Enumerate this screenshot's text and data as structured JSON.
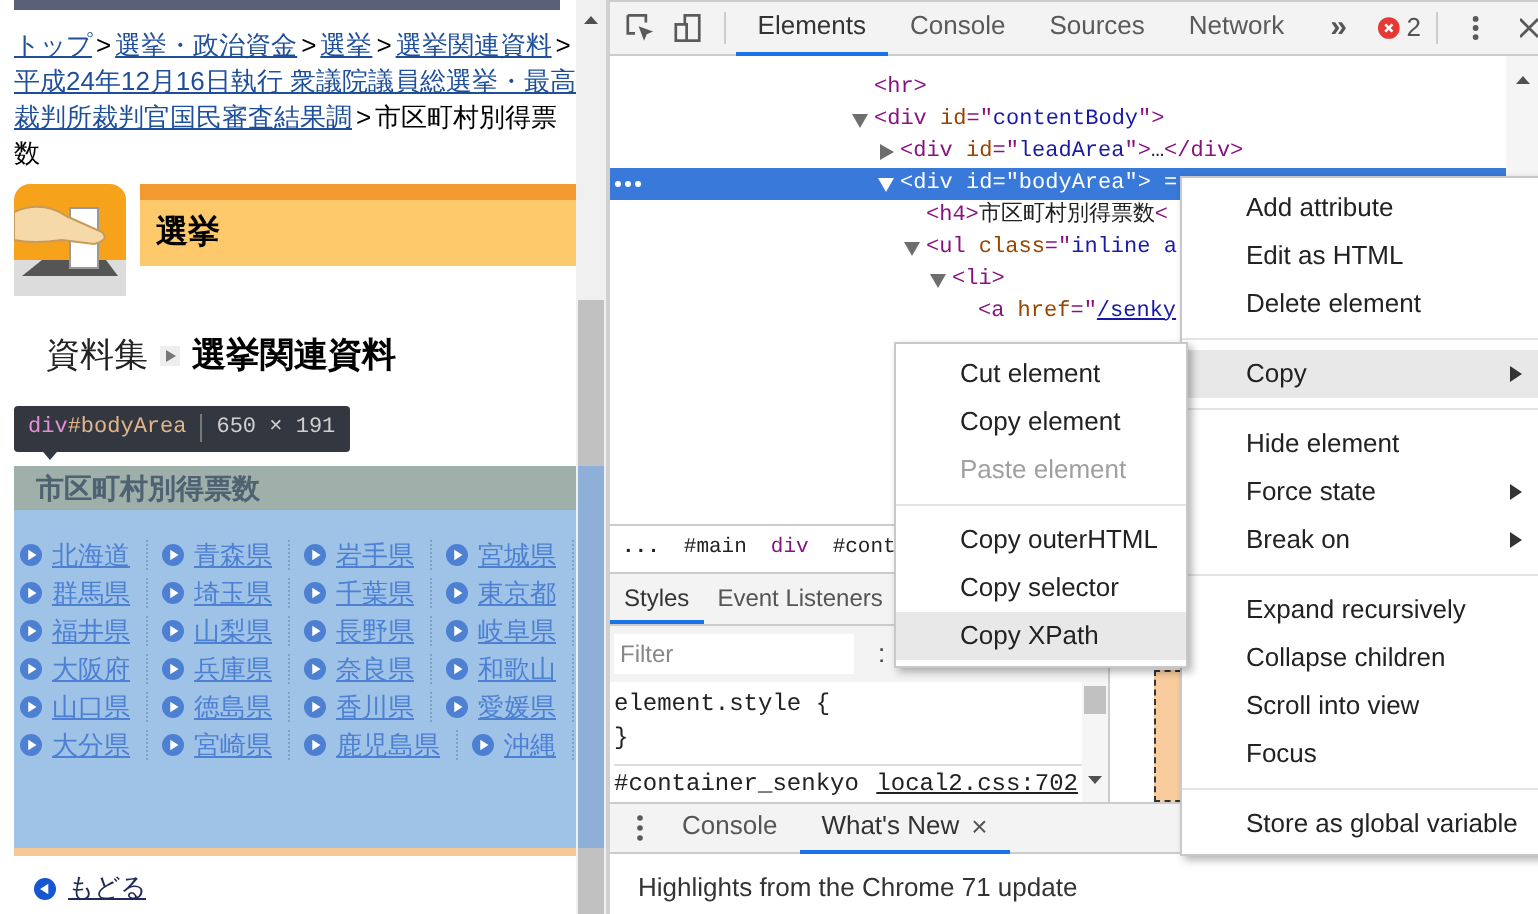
{
  "page": {
    "breadcrumb": [
      {
        "kind": "link",
        "text": "トップ"
      },
      {
        "kind": "separator",
        "text": ">"
      },
      {
        "kind": "link",
        "text": "選挙・政治資金"
      },
      {
        "kind": "separator",
        "text": ">"
      },
      {
        "kind": "link",
        "text": "選挙"
      },
      {
        "kind": "separator",
        "text": ">"
      },
      {
        "kind": "link",
        "text": "選挙関連資料"
      },
      {
        "kind": "separator",
        "text": ">"
      },
      {
        "kind": "link",
        "text": "平成24年12月16日執行 衆議院議員総選挙・最高裁判所裁判官国民審査結果調"
      },
      {
        "kind": "separator",
        "text": ">"
      },
      {
        "kind": "current",
        "text": "市区町村別得票数"
      }
    ],
    "banner_title": "選挙",
    "section": {
      "parent": "資料集",
      "current": "選挙関連資料"
    },
    "inspect_tooltip": {
      "tag": "div",
      "id": "#bodyArea",
      "size": "650 × 191"
    },
    "heading": "市区町村別得票数",
    "prefecture_rows": [
      [
        "北海道",
        "青森県",
        "岩手県",
        "宮城県"
      ],
      [
        "群馬県",
        "埼玉県",
        "千葉県",
        "東京都"
      ],
      [
        "福井県",
        "山梨県",
        "長野県",
        "岐阜県"
      ],
      [
        "大阪府",
        "兵庫県",
        "奈良県",
        "和歌山"
      ],
      [
        "山口県",
        "徳島県",
        "香川県",
        "愛媛県"
      ],
      [
        "大分県",
        "宮崎県",
        "鹿児島県",
        "沖縄"
      ]
    ],
    "back_link": "もどる"
  },
  "devtools": {
    "toolbar_tabs": [
      {
        "label": "Elements",
        "selected": true
      },
      {
        "label": "Console",
        "selected": false
      },
      {
        "label": "Sources",
        "selected": false
      },
      {
        "label": "Network",
        "selected": false
      }
    ],
    "overflow": "»",
    "error_count": "2",
    "tree": [
      {
        "kind": "leaf",
        "selected": false,
        "parts": [
          {
            "kind": "tag",
            "text": "<hr>"
          }
        ]
      },
      {
        "kind": "element",
        "expanded": true,
        "selected": false,
        "parts": [
          {
            "kind": "tag",
            "text": "<div"
          },
          {
            "kind": "attr",
            "text": " id"
          },
          {
            "kind": "tag",
            "text": "=\""
          },
          {
            "kind": "value",
            "text": "contentBody"
          },
          {
            "kind": "tag",
            "text": "\">"
          }
        ],
        "children": [
          {
            "kind": "element",
            "expanded": false,
            "selected": false,
            "parts": [
              {
                "kind": "tag",
                "text": "<div"
              },
              {
                "kind": "attr",
                "text": " id"
              },
              {
                "kind": "tag",
                "text": "=\""
              },
              {
                "kind": "value",
                "text": "leadArea"
              },
              {
                "kind": "tag",
                "text": "\">"
              },
              {
                "kind": "text",
                "text": "…"
              },
              {
                "kind": "tag",
                "text": "</div>"
              }
            ]
          },
          {
            "kind": "element",
            "expanded": true,
            "selected": true,
            "parts": [
              {
                "kind": "tag",
                "text": "<div"
              },
              {
                "kind": "attr",
                "text": " id"
              },
              {
                "kind": "tag",
                "text": "=\""
              },
              {
                "kind": "value",
                "text": "bodyArea"
              },
              {
                "kind": "tag",
                "text": "\">"
              },
              {
                "kind": "text",
                "text": " ="
              }
            ],
            "children": [
              {
                "kind": "leaf",
                "selected": false,
                "parts": [
                  {
                    "kind": "tag",
                    "text": "<h4>"
                  },
                  {
                    "kind": "text",
                    "text": "市区町村別得票数"
                  },
                  {
                    "kind": "tag",
                    "text": "<"
                  }
                ]
              },
              {
                "kind": "element",
                "expanded": true,
                "selected": false,
                "parts": [
                  {
                    "kind": "tag",
                    "text": "<ul"
                  },
                  {
                    "kind": "attr",
                    "text": " class"
                  },
                  {
                    "kind": "tag",
                    "text": "=\""
                  },
                  {
                    "kind": "value",
                    "text": "inline a"
                  }
                ],
                "children": [
                  {
                    "kind": "element",
                    "expanded": true,
                    "selected": false,
                    "parts": [
                      {
                        "kind": "tag",
                        "text": "<li>"
                      }
                    ],
                    "children": [
                      {
                        "kind": "leaf",
                        "selected": false,
                        "parts": [
                          {
                            "kind": "tag",
                            "text": "<a"
                          },
                          {
                            "kind": "attr",
                            "text": " href"
                          },
                          {
                            "kind": "tag",
                            "text": "=\""
                          },
                          {
                            "kind": "link",
                            "text": "/senky"
                          }
                        ]
                      }
                    ]
                  }
                ]
              }
            ]
          }
        ]
      }
    ],
    "breadcrumbs": [
      {
        "kind": "plain",
        "text": "..."
      },
      {
        "kind": "id",
        "text": "#main"
      },
      {
        "kind": "tag",
        "text": "div"
      },
      {
        "kind": "id",
        "text": "#cont"
      }
    ],
    "style_tabs": [
      {
        "label": "Styles",
        "selected": true
      },
      {
        "label": "Event Listeners",
        "selected": false
      }
    ],
    "filter_placeholder": "Filter",
    "filter_toggle": ":",
    "style_lines": [
      {
        "kind": "code",
        "text": "element.style {"
      },
      {
        "kind": "code",
        "text": "}"
      },
      {
        "kind": "rule",
        "text": "#container_senkyo",
        "source": "local2.css:702"
      }
    ],
    "drawer_tabs": [
      {
        "label": "Console",
        "selected": false,
        "closable": false
      },
      {
        "label": "What's New",
        "selected": true,
        "closable": true
      }
    ],
    "close_glyph": "×",
    "drawer_text": "Highlights from the Chrome 71 update"
  },
  "context_menu": {
    "groups": [
      [
        {
          "label": "Add attribute",
          "selected": false,
          "has_submenu": false,
          "disabled": false
        },
        {
          "label": "Edit as HTML",
          "selected": false,
          "has_submenu": false,
          "disabled": false
        },
        {
          "label": "Delete element",
          "selected": false,
          "has_submenu": false,
          "disabled": false
        }
      ],
      [
        {
          "label": "Copy",
          "selected": true,
          "has_submenu": true,
          "disabled": false
        }
      ],
      [
        {
          "label": "Hide element",
          "selected": false,
          "has_submenu": false,
          "disabled": false
        },
        {
          "label": "Force state",
          "selected": false,
          "has_submenu": true,
          "disabled": false
        },
        {
          "label": "Break on",
          "selected": false,
          "has_submenu": true,
          "disabled": false
        }
      ],
      [
        {
          "label": "Expand recursively",
          "selected": false,
          "has_submenu": false,
          "disabled": false
        },
        {
          "label": "Collapse children",
          "selected": false,
          "has_submenu": false,
          "disabled": false
        },
        {
          "label": "Scroll into view",
          "selected": false,
          "has_submenu": false,
          "disabled": false
        },
        {
          "label": "Focus",
          "selected": false,
          "has_submenu": false,
          "disabled": false
        }
      ],
      [
        {
          "label": "Store as global variable",
          "selected": false,
          "has_submenu": false,
          "disabled": false
        }
      ]
    ]
  },
  "submenu": {
    "groups": [
      [
        {
          "label": "Cut element",
          "selected": false,
          "has_submenu": false,
          "disabled": false
        },
        {
          "label": "Copy element",
          "selected": false,
          "has_submenu": false,
          "disabled": false
        },
        {
          "label": "Paste element",
          "selected": false,
          "has_submenu": false,
          "disabled": true
        }
      ],
      [
        {
          "label": "Copy outerHTML",
          "selected": false,
          "has_submenu": false,
          "disabled": false
        },
        {
          "label": "Copy selector",
          "selected": false,
          "has_submenu": false,
          "disabled": false
        },
        {
          "label": "Copy XPath",
          "selected": true,
          "has_submenu": false,
          "disabled": false
        }
      ]
    ]
  }
}
